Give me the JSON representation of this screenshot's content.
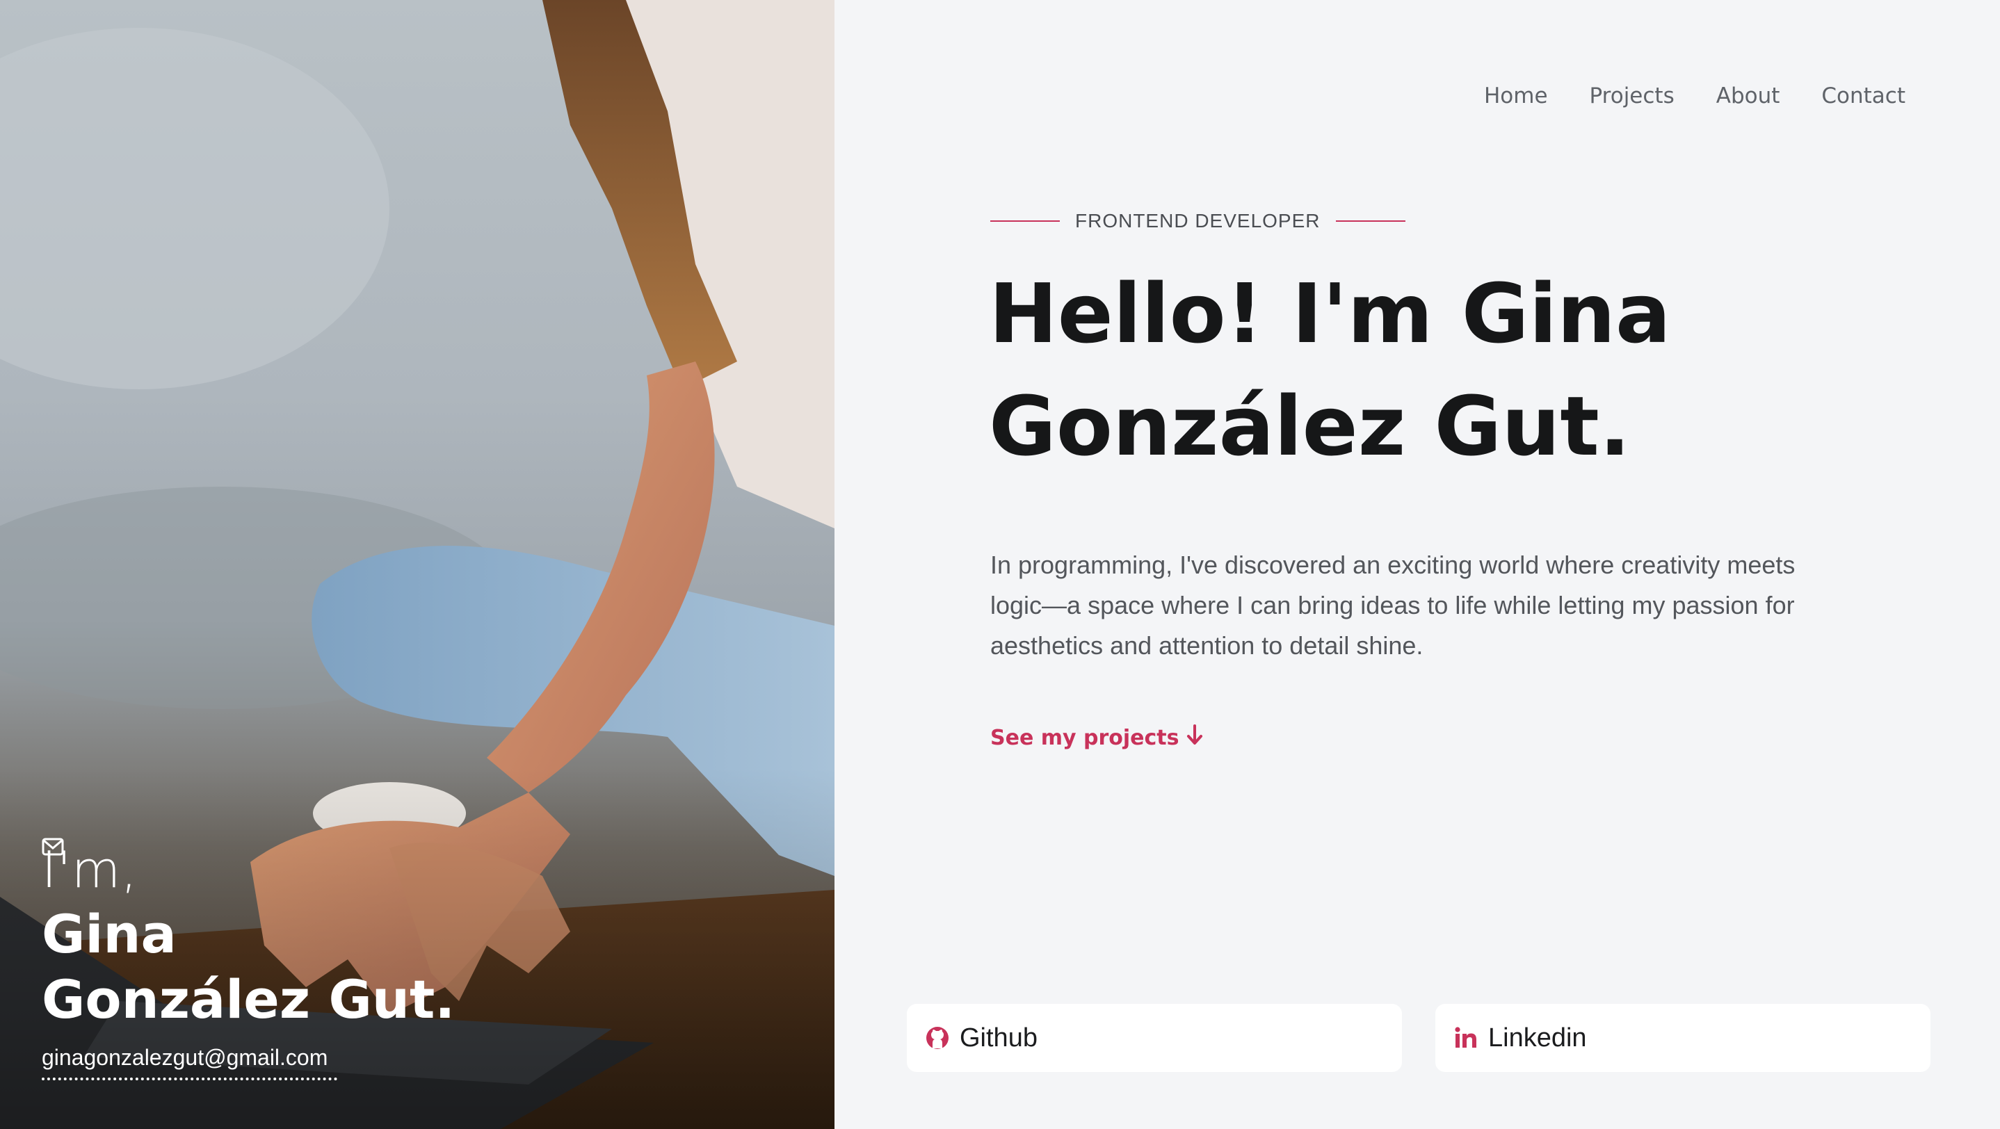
{
  "hero_panel": {
    "intro": "I'm,",
    "first_name": "Gina",
    "last_name": "González Gut.",
    "email": "ginagonzalezgut@gmail.com",
    "email_icon": "envelope-icon"
  },
  "nav": {
    "items": [
      {
        "label": "Home"
      },
      {
        "label": "Projects"
      },
      {
        "label": "About"
      },
      {
        "label": "Contact"
      }
    ]
  },
  "main": {
    "role": "FRONTEND DEVELOPER",
    "headline_line1": "Hello! I'm Gina",
    "headline_line2": "González Gut.",
    "bio": "In programming, I've discovered an exciting world where creativity meets logic—a space where I can bring ideas to life while letting my passion for aesthetics and attention to detail shine.",
    "cta_label": "See my projects",
    "cta_icon": "arrow-down-icon"
  },
  "socials": [
    {
      "label": "Github",
      "icon": "github-icon"
    },
    {
      "label": "Linkedin",
      "icon": "linkedin-icon"
    }
  ],
  "colors": {
    "accent": "#c8325a",
    "background": "#f4f5f7",
    "headline": "#161718",
    "text": "#53565b",
    "nav": "#5f6369"
  }
}
